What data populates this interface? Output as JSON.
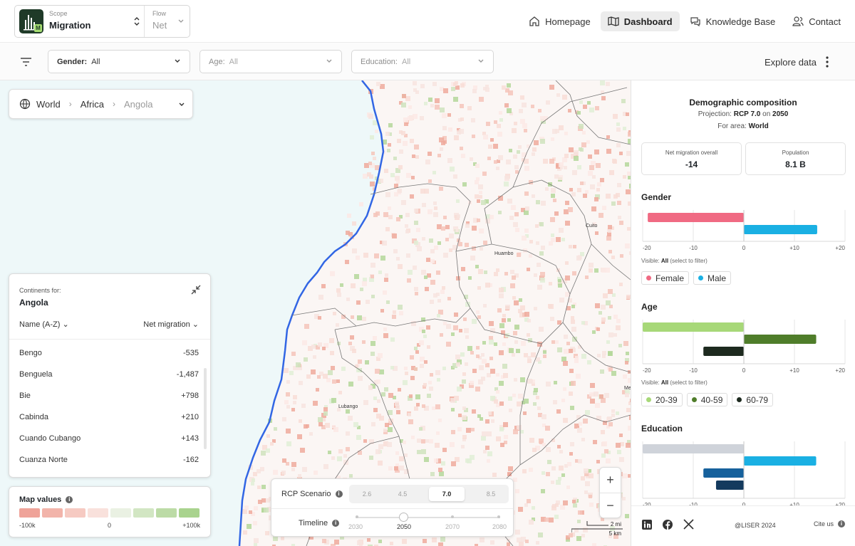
{
  "header": {
    "scope_caption": "Scope",
    "scope_value": "Migration",
    "flow_caption": "Flow",
    "flow_value": "Net",
    "nav": [
      {
        "label": "Homepage",
        "icon": "home-icon"
      },
      {
        "label": "Dashboard",
        "icon": "map-icon",
        "active": true
      },
      {
        "label": "Knowledge Base",
        "icon": "chat-icon"
      },
      {
        "label": "Contact",
        "icon": "people-icon"
      }
    ]
  },
  "filters": {
    "gender_label": "Gender:",
    "gender_value": "All",
    "age_label": "Age:",
    "age_value": "All",
    "education_label": "Education:",
    "education_value": "All",
    "explore_label": "Explore data"
  },
  "breadcrumb": {
    "world": "World",
    "continent": "Africa",
    "country": "Angola"
  },
  "map_labels": {
    "city1": "Cuito",
    "city2": "Huambo",
    "city3": "Lubango",
    "edge": "Me"
  },
  "regions": {
    "caption": "Continents for:",
    "title": "Angola",
    "sort_label": "Name (A-Z)",
    "metric_label": "Net migration",
    "rows": [
      {
        "name": "Bengo",
        "value": "-535"
      },
      {
        "name": "Benguela",
        "value": "-1,487"
      },
      {
        "name": "Bie",
        "value": "+798"
      },
      {
        "name": "Cabinda",
        "value": "+210"
      },
      {
        "name": "Cuando Cubango",
        "value": "+143"
      },
      {
        "name": "Cuanza Norte",
        "value": "-162"
      }
    ]
  },
  "legend": {
    "title": "Map values",
    "min": "-100k",
    "mid": "0",
    "max": "+100k",
    "colors": [
      "#efa399",
      "#f2b4aa",
      "#f6cac2",
      "#f9e1dc",
      "#eaf1e3",
      "#d2e6c3",
      "#bcdba6",
      "#a9d38e"
    ]
  },
  "rcp": {
    "scenario_label": "RCP Scenario",
    "scenarios": [
      "2.6",
      "4.5",
      "7.0",
      "8.5"
    ],
    "selected_scenario": "7.0",
    "timeline_label": "Timeline",
    "years": [
      "2030",
      "2050",
      "2070",
      "2080"
    ],
    "selected_year": "2050"
  },
  "zoom": {
    "in": "+",
    "out": "−"
  },
  "scale": {
    "top": "2 mi",
    "bottom": "5 km"
  },
  "panel": {
    "title": "Demographic composition",
    "projection_prefix": "Projection:",
    "projection_value": "RCP 7.0",
    "on_text": "on",
    "projection_year": "2050",
    "area_prefix": "For area:",
    "area_value": "World",
    "kpi_migration_label": "Net migration overall",
    "kpi_migration_value": "-14",
    "kpi_population_label": "Population",
    "kpi_population_value": "8.1 B",
    "gender_title": "Gender",
    "age_title": "Age",
    "education_title": "Education",
    "visible_prefix": "Visible:",
    "visible_value": "All",
    "visible_hint": "(select to filter)",
    "gender_chips": [
      {
        "label": "Female",
        "color": "#f06a83"
      },
      {
        "label": "Male",
        "color": "#1ab0e3"
      }
    ],
    "age_chips": [
      {
        "label": "20-39",
        "color": "#a7d878"
      },
      {
        "label": "40-59",
        "color": "#4f7d2a"
      },
      {
        "label": "60-79",
        "color": "#1d2a1f"
      }
    ],
    "footer_copy": "@LISER 2024",
    "cite_label": "Cite us"
  },
  "chart_data": [
    {
      "type": "bar",
      "title": "Gender",
      "xlim": [
        -20,
        20
      ],
      "ticks": [
        "-20",
        "-10",
        "0",
        "+10",
        "+20"
      ],
      "series": [
        {
          "name": "Female",
          "values": [
            -19
          ],
          "color": "#f06a83"
        },
        {
          "name": "Male",
          "values": [
            14.5
          ],
          "color": "#1ab0e3"
        }
      ]
    },
    {
      "type": "bar",
      "title": "Age",
      "xlim": [
        -20,
        20
      ],
      "ticks": [
        "-20",
        "-10",
        "0",
        "+10",
        "+20"
      ],
      "series": [
        {
          "name": "20-39",
          "values": [
            -20
          ],
          "color": "#a7d878"
        },
        {
          "name": "40-59",
          "values": [
            14.3
          ],
          "color": "#4f7d2a"
        },
        {
          "name": "60-79",
          "values": [
            -8
          ],
          "color": "#1d2a1f"
        }
      ]
    },
    {
      "type": "bar",
      "title": "Education",
      "xlim": [
        -20,
        20
      ],
      "ticks": [
        "-20",
        "-10",
        "0",
        "+10",
        "+20"
      ],
      "series": [
        {
          "values": [
            -20
          ],
          "color": "#cfd3da"
        },
        {
          "values": [
            14.3
          ],
          "color": "#1ab0e3"
        },
        {
          "values": [
            -8
          ],
          "color": "#16619c"
        },
        {
          "values": [
            -5.5
          ],
          "color": "#143a5e"
        }
      ]
    }
  ]
}
